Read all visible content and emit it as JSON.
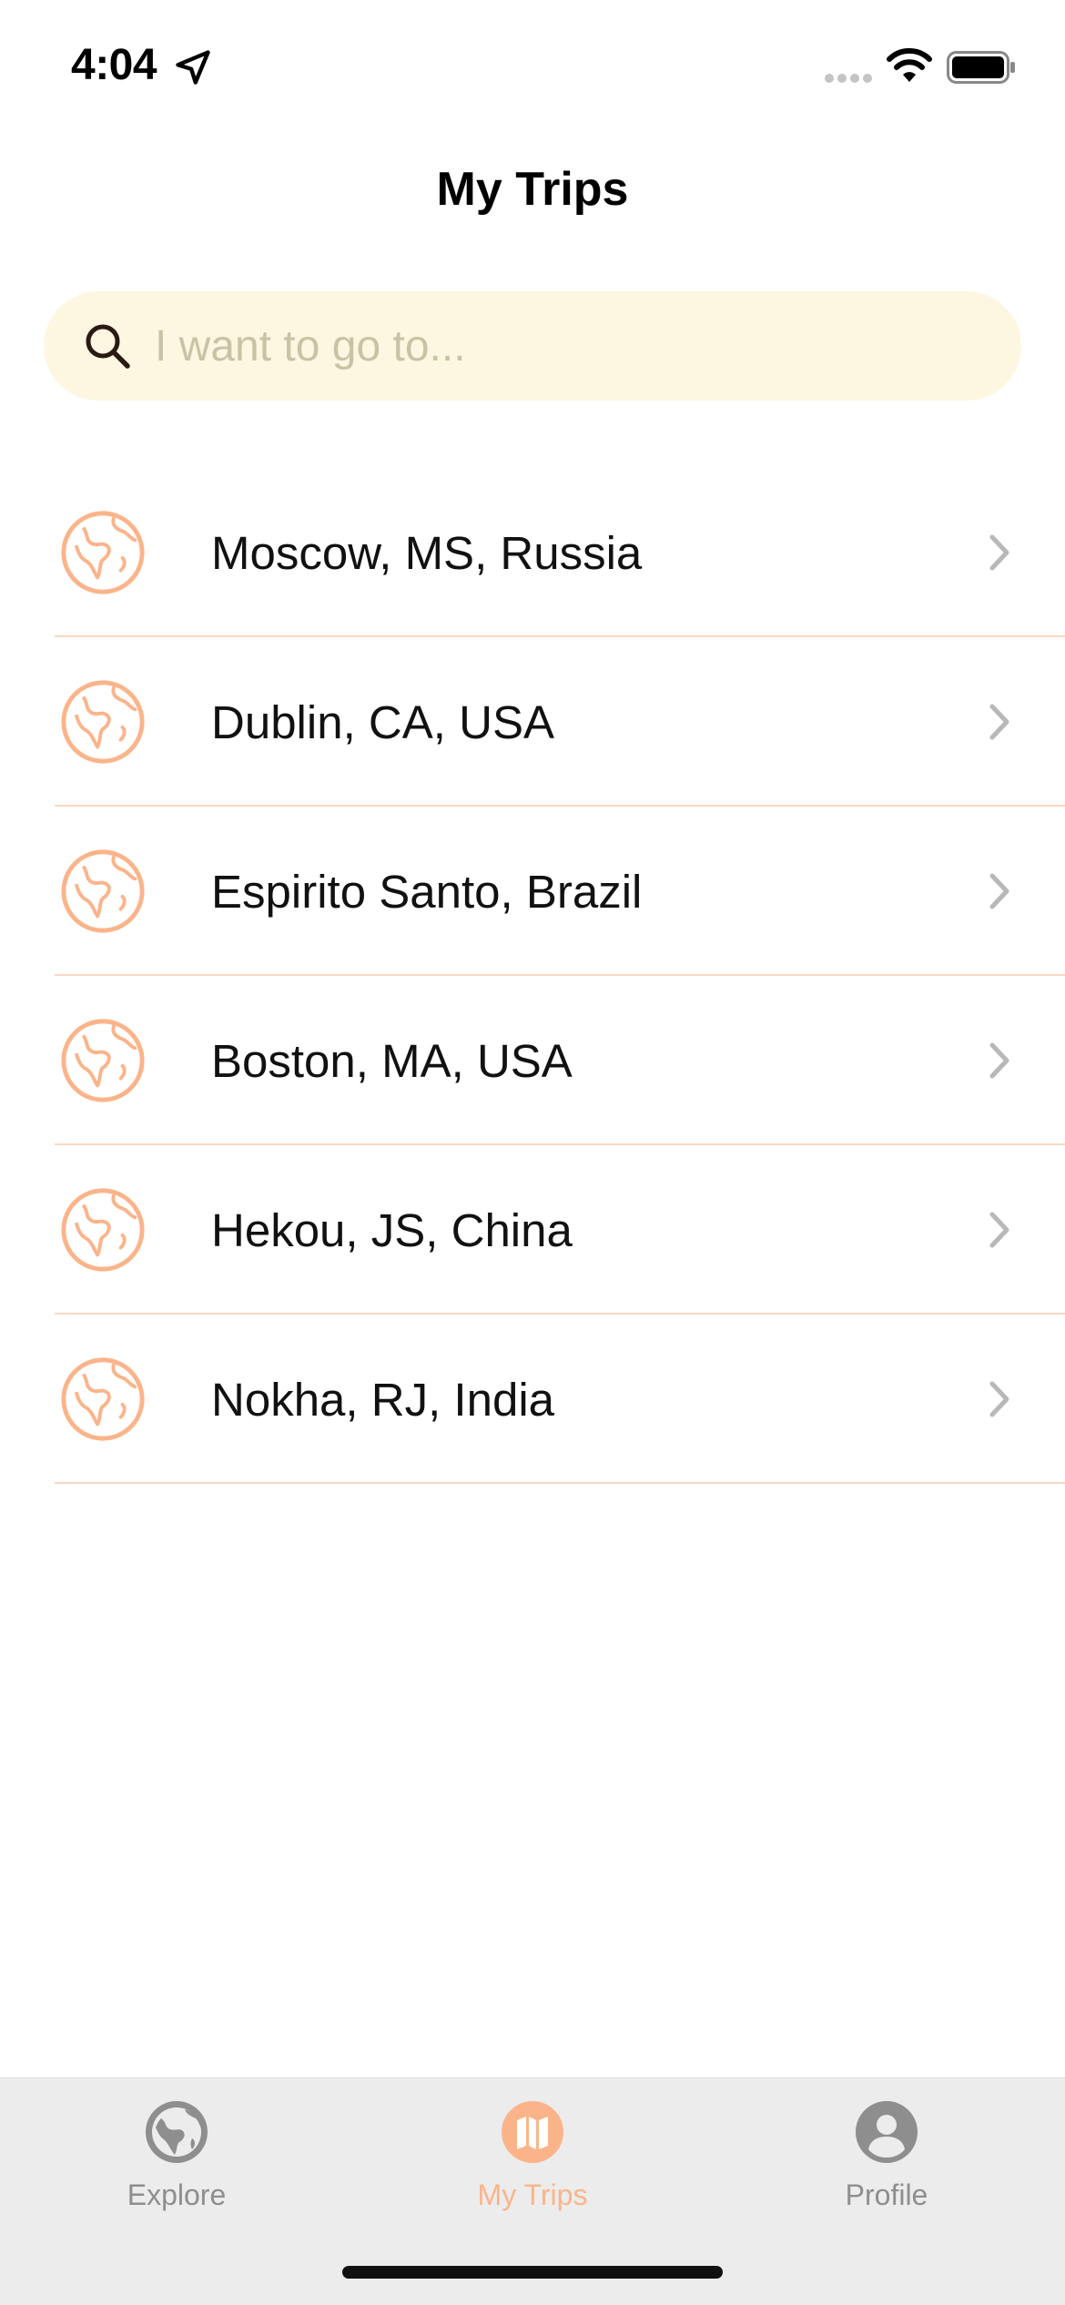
{
  "status_bar": {
    "time": "4:04"
  },
  "header": {
    "title": "My Trips"
  },
  "search": {
    "placeholder": "I want to go to...",
    "value": ""
  },
  "trips": [
    {
      "label": "Moscow, MS, Russia"
    },
    {
      "label": "Dublin, CA, USA"
    },
    {
      "label": "Espirito Santo, Brazil"
    },
    {
      "label": "Boston, MA, USA"
    },
    {
      "label": "Hekou, JS, China"
    },
    {
      "label": "Nokha, RJ, India"
    }
  ],
  "tab_bar": {
    "tabs": [
      {
        "label": "Explore",
        "icon": "globe-icon",
        "active": false
      },
      {
        "label": "My Trips",
        "icon": "map-icon",
        "active": true
      },
      {
        "label": "Profile",
        "icon": "person-icon",
        "active": false
      }
    ]
  },
  "colors": {
    "accent": "#fbb48a",
    "search_background": "#fdf7e1",
    "divider": "#fbd8c0",
    "tab_bar_background": "#ececec",
    "inactive_tab": "#8e8e8e"
  }
}
